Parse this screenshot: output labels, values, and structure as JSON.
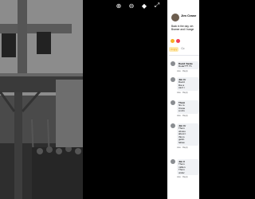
{
  "viewer": {
    "toolbar": [
      {
        "name": "zoom-in-icon",
        "glyph": "⊕"
      },
      {
        "name": "zoom-out-icon",
        "glyph": "⊖"
      },
      {
        "name": "tag-icon",
        "glyph": "◆"
      },
      {
        "name": "fullscreen-icon",
        "glyph": "⤢"
      }
    ]
  },
  "post": {
    "author": "Jim Crane",
    "meta": "·",
    "text_lines": [
      "Back in the day, wh",
      "Bramer and I hange"
    ],
    "actions": {
      "react": "Angry",
      "reply": "Co"
    }
  },
  "comments": [
    {
      "name": "David Vande",
      "lines": [
        "Dude??? Th"
      ],
      "meta": "Like · Reply"
    },
    {
      "name": "Jim Cr",
      "lines": [
        "David",
        "like a",
        "can't r"
      ],
      "meta": "Like · Reply"
    },
    {
      "name": "Thom",
      "lines": [
        "fire to",
        "Crane",
        "a refu"
      ],
      "meta": "Like · Reply"
    },
    {
      "name": "Jim Cr",
      "lines": [
        "Thom",
        "obviou",
        "about t",
        "this is",
        "gettin",
        "fellow"
      ],
      "meta": "Like · Reply"
    },
    {
      "name": "Jim C",
      "lines": [
        "Thom",
        "million",
        "Thom",
        "under"
      ],
      "meta": "Like · Reply"
    }
  ]
}
